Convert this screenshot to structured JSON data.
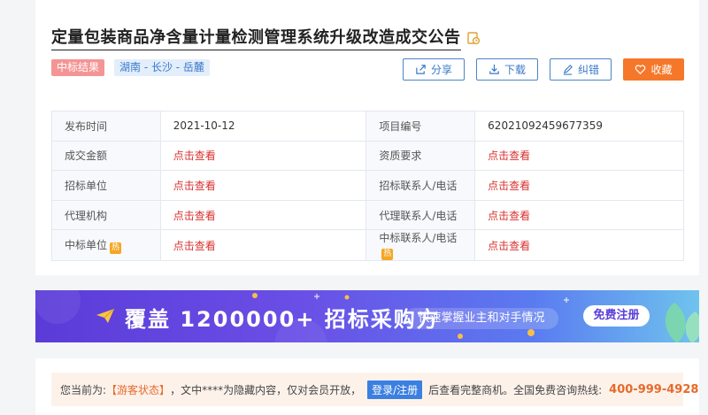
{
  "header": {
    "title": "定量包装商品净含量计量检测管理系统升级改造成交公告",
    "tags": [
      "中标结果",
      "湖南 - 长沙 - 岳麓"
    ]
  },
  "actions": {
    "share": "分享",
    "download": "下载",
    "error": "纠错",
    "favorite": "收藏"
  },
  "info": {
    "rows": [
      [
        "发布时间",
        "2021-10-12",
        "项目编号",
        "62021092459677359"
      ],
      [
        "成交金额",
        "点击查看",
        "资质要求",
        "点击查看"
      ],
      [
        "招标单位",
        "点击查看",
        "招标联系人/电话",
        "点击查看"
      ],
      [
        "代理机构",
        "点击查看",
        "代理联系人/电话",
        "点击查看"
      ],
      [
        "中标单位",
        "点击查看",
        "中标联系人/电话",
        "点击查看"
      ]
    ],
    "hot_badge": "热"
  },
  "banner": {
    "headline": "覆盖 1200000+ 招标采购方",
    "subline": "快速掌握业主和对手情况",
    "cta": "免费注册"
  },
  "notice": {
    "prefix": "您当前为:",
    "status": "【游客状态】",
    "middle": "，文中****为隐藏内容，仅对会员开放，",
    "login": "登录/注册",
    "after": "后查看完整商机。全国免费咨询热线:",
    "phone": "400-999-4928"
  },
  "colors": {
    "accent_blue": "#3a78c9",
    "favorite_orange": "#f5782a",
    "link_red": "#d9312f"
  }
}
